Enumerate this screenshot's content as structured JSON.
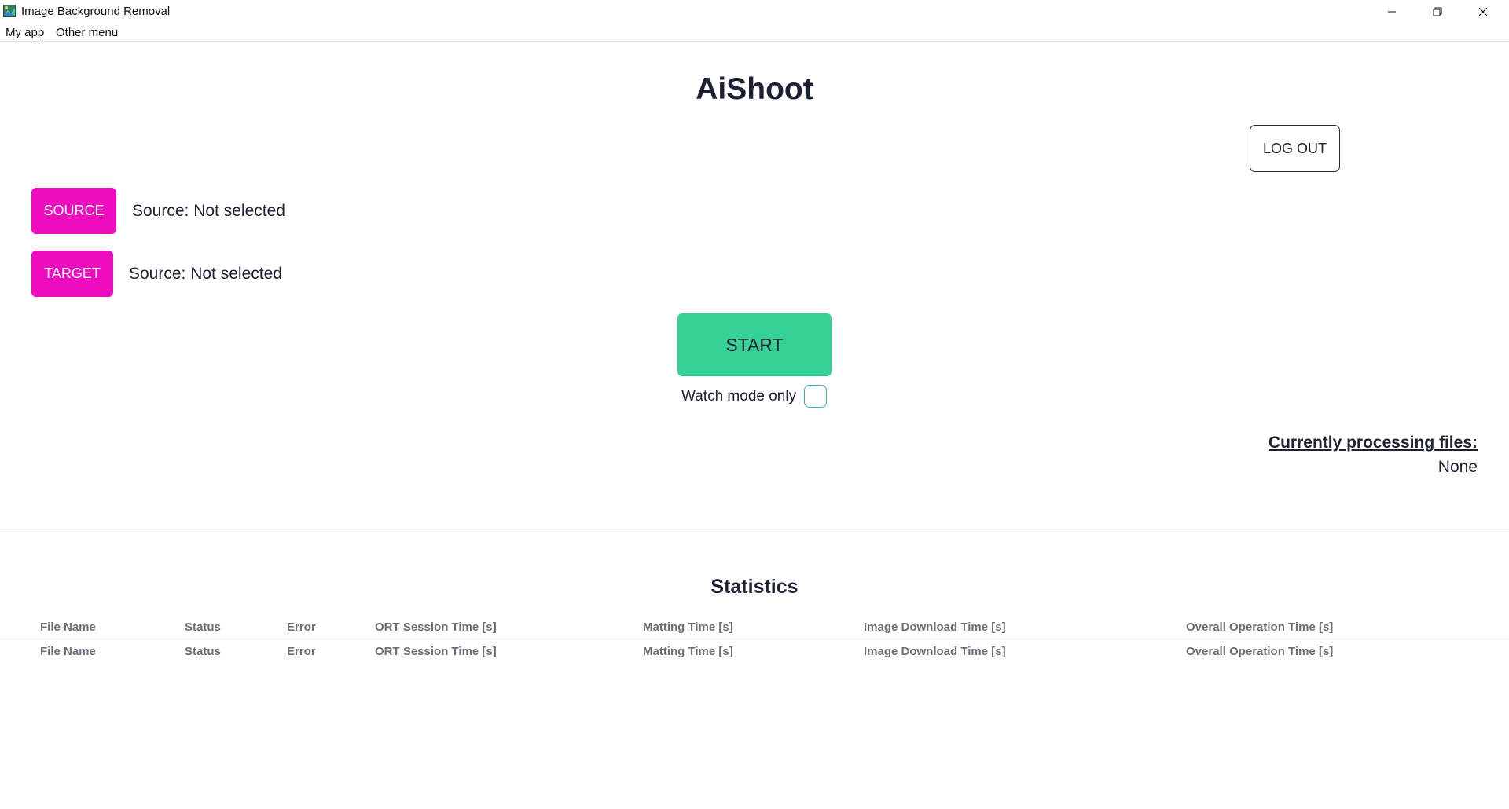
{
  "window": {
    "title": "Image Background Removal",
    "icon": "app-image-icon"
  },
  "menu": {
    "items": [
      "My app",
      "Other menu"
    ]
  },
  "main": {
    "app_title": "AiShoot",
    "logout_label": "LOG OUT",
    "source_button": "SOURCE",
    "source_status": "Source: Not selected",
    "target_button": "TARGET",
    "target_status": "Source: Not selected",
    "start_label": "START",
    "watch_mode_label": "Watch mode only",
    "watch_mode_checked": false,
    "processing_heading": "Currently processing files:",
    "processing_value": "None"
  },
  "statistics": {
    "heading": "Statistics",
    "columns": [
      "File Name",
      "Status",
      "Error",
      "ORT Session Time [s]",
      "Matting Time [s]",
      "Image Download Time [s]",
      "Overall Operation Time [s]"
    ],
    "rows": [
      [
        "File Name",
        "Status",
        "Error",
        "ORT Session Time [s]",
        "Matting Time [s]",
        "Image Download Time [s]",
        "Overall Operation Time [s]"
      ]
    ]
  },
  "colors": {
    "accent_pink": "#ee0cbf",
    "start_green": "#35d296",
    "checkbox_border": "#2bb3d4",
    "text_dark": "#1c2233",
    "table_text": "#6b6e78"
  }
}
